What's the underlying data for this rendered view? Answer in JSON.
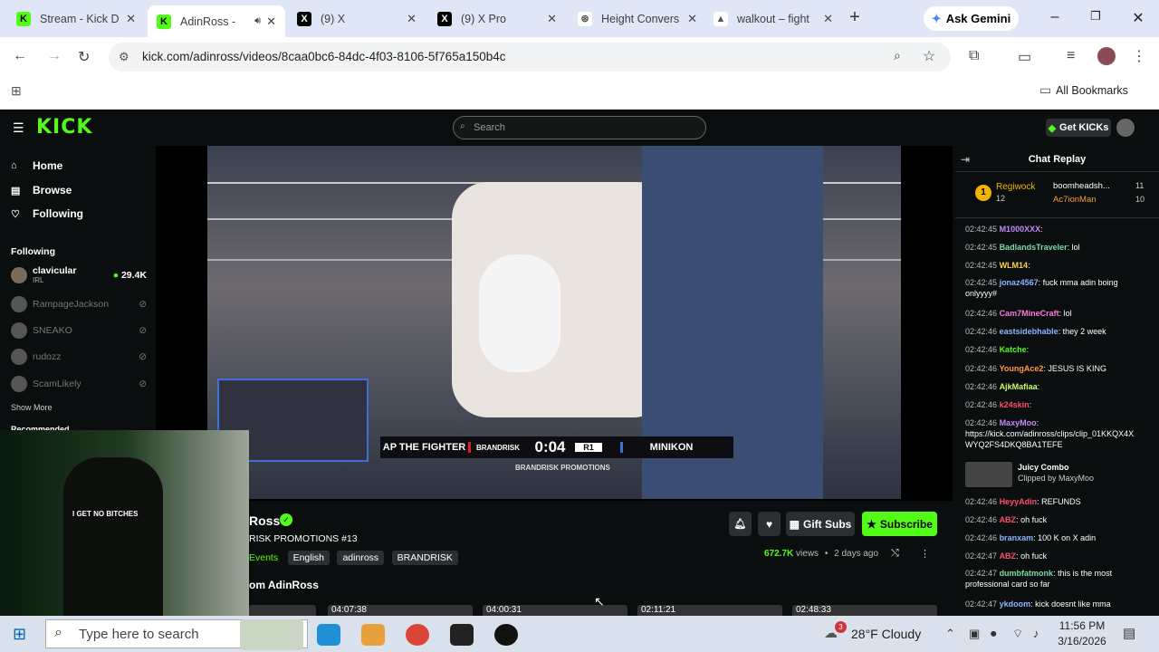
{
  "browser": {
    "tabs": [
      {
        "title": "Stream - Kick D",
        "color": "#53fc18",
        "glyph": "K"
      },
      {
        "title": "AdinRoss -",
        "color": "#53fc18",
        "glyph": "K",
        "active": true
      },
      {
        "title": "(9) X",
        "color": "#000000",
        "glyph": "X"
      },
      {
        "title": "(9) X Pro",
        "color": "#000000",
        "glyph": "X"
      },
      {
        "title": "Height Convers",
        "color": "#ffffff",
        "glyph": "⊛"
      },
      {
        "title": "walkout – fight",
        "color": "#ffffff",
        "glyph": "▲"
      }
    ],
    "new_tab": "+",
    "gemini": "Ask Gemini",
    "url": "kick.com/adinross/videos/8caa0bc6-84dc-4f03-8106-5f765a150b4c",
    "all_bookmarks": "All Bookmarks"
  },
  "kick": {
    "logo": "KICK",
    "search_placeholder": "Search",
    "get_kicks": "Get KICKs",
    "nav": [
      "Home",
      "Browse",
      "Following"
    ],
    "following_header": "Following",
    "followed": [
      {
        "name": "clavicular",
        "sub": "IRL",
        "viewers": "29.4K",
        "live": true
      },
      {
        "name": "RampageJackson"
      },
      {
        "name": "SNEAKO"
      },
      {
        "name": "rudozz"
      },
      {
        "name": "ScamLikely"
      }
    ],
    "show_more": "Show More",
    "recommended": "Recommended"
  },
  "video": {
    "fighter_left": "AP THE FIGHTER",
    "promo": "BRANDRISK",
    "clock": "0:04",
    "round": "R1",
    "fighter_right": "MINIKON",
    "promo_sub": "BRANDRISK PROMOTIONS",
    "webcam_shirt": "I GET NO BITCHES"
  },
  "info": {
    "channel": "Ross",
    "title": "RISK PROMOTIONS #13",
    "category": "Events",
    "tags": [
      "English",
      "adinross",
      "BRANDRISK"
    ],
    "views": "672.7K",
    "views_label": "views",
    "ago": "2 days ago",
    "gift_subs": "Gift Subs",
    "subscribe": "Subscribe",
    "more_from": "om AdinRoss",
    "durations": [
      "04:07:38",
      "04:00:31",
      "02:11:21",
      "02:48:33"
    ]
  },
  "chat": {
    "header": "Chat Replay",
    "top_gifter": {
      "name": "Regiwock",
      "count": "12"
    },
    "gifters": [
      {
        "name": "boomheadsh...",
        "count": "11"
      },
      {
        "name": "Ac7ionMan",
        "count": "10"
      }
    ],
    "messages": [
      {
        "time": "02:42:45",
        "user": "M1000XXX",
        "color": "#c58af9",
        "text": ""
      },
      {
        "time": "02:42:45",
        "user": "BadlandsTraveler",
        "color": "#7fd9a6",
        "text": "lol"
      },
      {
        "time": "02:42:45",
        "user": "WLM14",
        "color": "#ffd24d",
        "text": ""
      },
      {
        "time": "02:42:45",
        "user": "jonaz4567",
        "color": "#8fb3ff",
        "text": "fuck mma adin boing onlyyyy#"
      },
      {
        "time": "02:42:46",
        "user": "Cam7MineCraft",
        "color": "#ff7ad9",
        "text": "lol"
      },
      {
        "time": "02:42:46",
        "user": "eastsidebhable",
        "color": "#8fb3ff",
        "text": "they 2 week"
      },
      {
        "time": "02:42:46",
        "user": "Katche",
        "color": "#53fc18",
        "text": ""
      },
      {
        "time": "02:42:46",
        "user": "YoungAce2",
        "color": "#ff9b42",
        "text": "JESUS IS KING"
      },
      {
        "time": "02:42:46",
        "user": "AjkMafiaa",
        "color": "#c7ff70",
        "text": ""
      },
      {
        "time": "02:42:46",
        "user": "k24skin",
        "color": "#ff4d6a",
        "text": ""
      },
      {
        "time": "02:42:46",
        "user": "MaxyMoo",
        "color": "#c58af9",
        "text": "https://kick.com/adinross/clips/clip_01KKQX4X WYQ2FS4DKQ8BA1TEFE"
      },
      {
        "time": "",
        "user": "Juicy Combo",
        "color": "#ffffff",
        "text": "Clipped by MaxyMoo"
      },
      {
        "time": "02:42:46",
        "user": "HeyyAdin",
        "color": "#ff4d6a",
        "text": "REFUNDS"
      },
      {
        "time": "02:42:46",
        "user": "ABZ",
        "color": "#ff4d6a",
        "text": "oh fuck"
      },
      {
        "time": "02:42:46",
        "user": "branxam",
        "color": "#8fb3ff",
        "text": "100 K on X adin"
      },
      {
        "time": "02:42:47",
        "user": "ABZ",
        "color": "#ff4d6a",
        "text": "oh fuck"
      },
      {
        "time": "02:42:47",
        "user": "dumbfatmonk",
        "color": "#7fd9a6",
        "text": "this is the most professional card so far"
      },
      {
        "time": "02:42:47",
        "user": "ykdoom",
        "color": "#8fb3ff",
        "text": "kick doesnt like mma"
      }
    ]
  },
  "taskbar": {
    "search": "Type here to search",
    "weather": "28°F  Cloudy",
    "badge": "3",
    "time": "11:56 PM",
    "date": "3/16/2026"
  }
}
